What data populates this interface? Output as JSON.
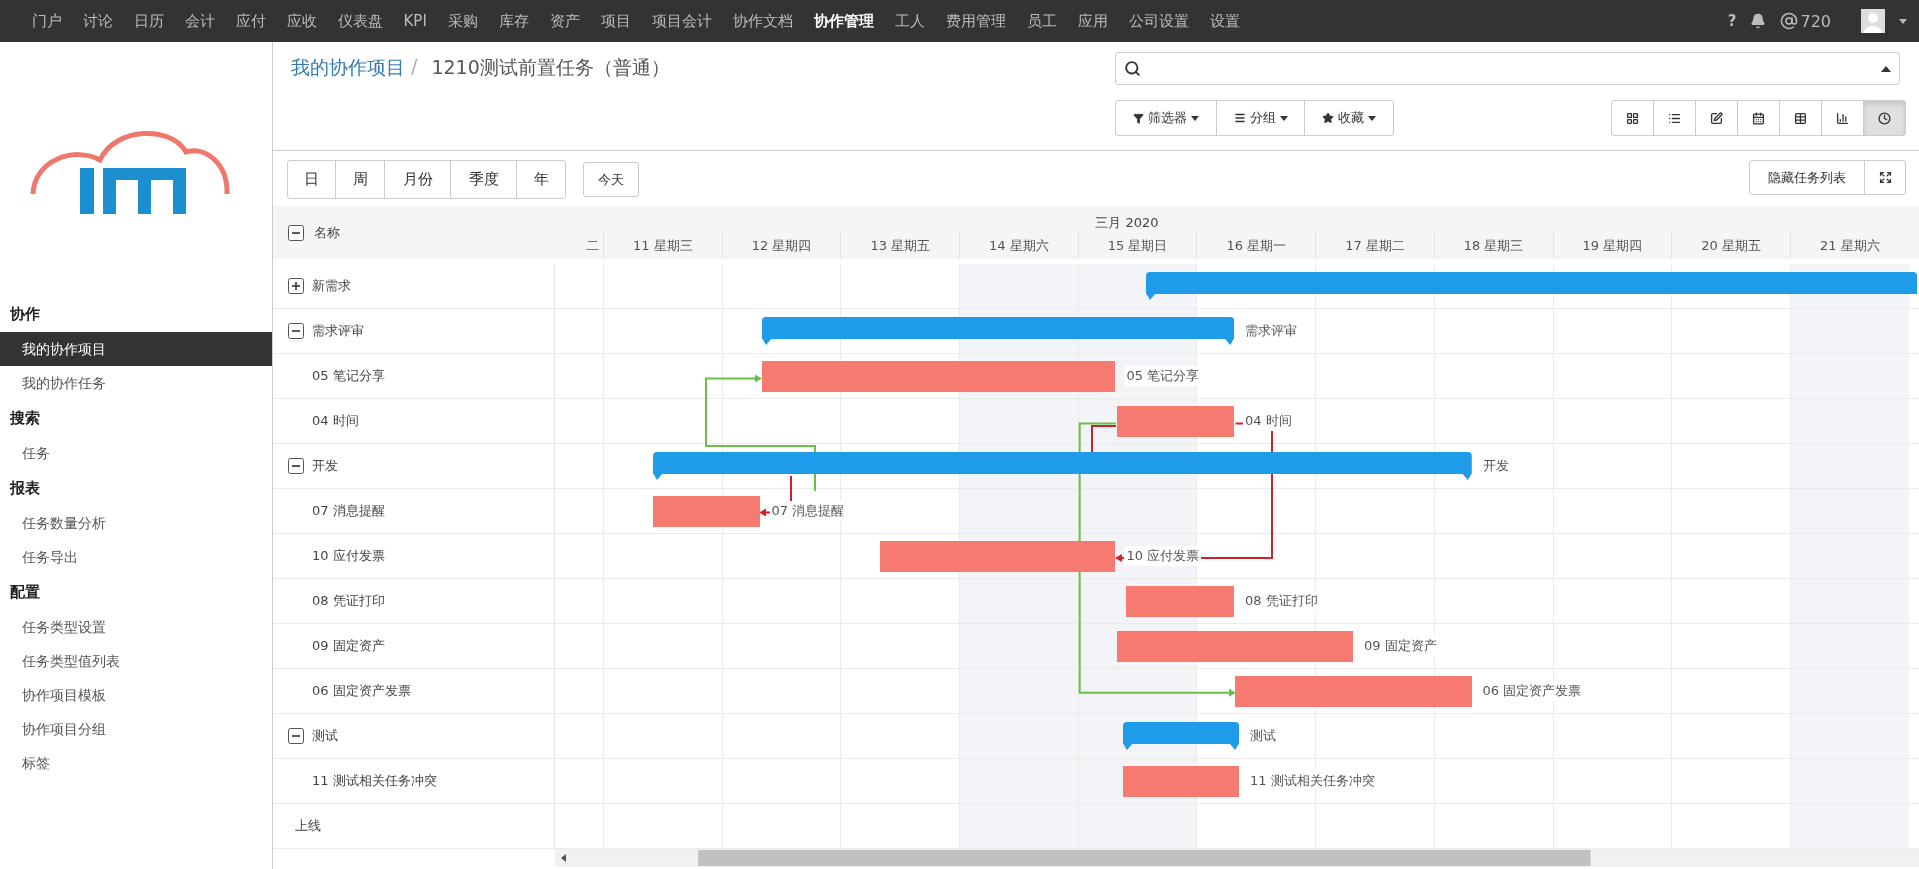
{
  "top_nav": {
    "items": [
      {
        "label": "门户",
        "selected": false
      },
      {
        "label": "讨论",
        "selected": false
      },
      {
        "label": "日历",
        "selected": false
      },
      {
        "label": "会计",
        "selected": false
      },
      {
        "label": "应付",
        "selected": false
      },
      {
        "label": "应收",
        "selected": false
      },
      {
        "label": "仪表盘",
        "selected": false
      },
      {
        "label": "KPI",
        "selected": false
      },
      {
        "label": "采购",
        "selected": false
      },
      {
        "label": "库存",
        "selected": false
      },
      {
        "label": "资产",
        "selected": false
      },
      {
        "label": "项目",
        "selected": false
      },
      {
        "label": "项目会计",
        "selected": false
      },
      {
        "label": "协作文档",
        "selected": false
      },
      {
        "label": "协作管理",
        "selected": true
      },
      {
        "label": "工人",
        "selected": false
      },
      {
        "label": "费用管理",
        "selected": false
      },
      {
        "label": "员工",
        "selected": false
      },
      {
        "label": "应用",
        "selected": false
      },
      {
        "label": "公司设置",
        "selected": false
      },
      {
        "label": "设置",
        "selected": false
      }
    ],
    "help": "?",
    "mentions": "720"
  },
  "sidebar": {
    "sections": [
      {
        "title": "协作",
        "items": [
          {
            "label": "我的协作项目",
            "selected": true
          },
          {
            "label": "我的协作任务",
            "selected": false
          }
        ]
      },
      {
        "title": "搜索",
        "items": [
          {
            "label": "任务",
            "selected": false
          }
        ]
      },
      {
        "title": "报表",
        "items": [
          {
            "label": "任务数量分析",
            "selected": false
          },
          {
            "label": "任务导出",
            "selected": false
          }
        ]
      },
      {
        "title": "配置",
        "items": [
          {
            "label": "任务类型设置",
            "selected": false
          },
          {
            "label": "任务类型值列表",
            "selected": false
          },
          {
            "label": "协作项目模板",
            "selected": false
          },
          {
            "label": "协作项目分组",
            "selected": false
          },
          {
            "label": "标签",
            "selected": false
          }
        ]
      }
    ]
  },
  "breadcrumb": {
    "parent": "我的协作项目",
    "separator": "/",
    "current": "1210测试前置任务（普通）"
  },
  "filters": [
    {
      "kind": "filter",
      "label": "筛选器"
    },
    {
      "kind": "group",
      "label": "分组"
    },
    {
      "kind": "favorite",
      "label": "收藏"
    }
  ],
  "views": [
    {
      "kind": "kanban",
      "selected": false
    },
    {
      "kind": "list",
      "selected": false
    },
    {
      "kind": "form",
      "selected": false
    },
    {
      "kind": "calendar",
      "selected": false
    },
    {
      "kind": "pivot",
      "selected": false
    },
    {
      "kind": "graph",
      "selected": false
    },
    {
      "kind": "gantt",
      "selected": true
    }
  ],
  "scales": [
    "日",
    "周",
    "月份",
    "季度",
    "年"
  ],
  "today": "今天",
  "hide_task_list": "隐藏任务列表",
  "gantt": {
    "name_header": "名称",
    "month": "三月 2020",
    "days": [
      {
        "label": "二",
        "weekend": false
      },
      {
        "label": "11 星期三",
        "weekend": false
      },
      {
        "label": "12 星期四",
        "weekend": false
      },
      {
        "label": "13 星期五",
        "weekend": false
      },
      {
        "label": "14 星期六",
        "weekend": true
      },
      {
        "label": "15 星期日",
        "weekend": true
      },
      {
        "label": "16 星期一",
        "weekend": false
      },
      {
        "label": "17 星期二",
        "weekend": false
      },
      {
        "label": "18 星期三",
        "weekend": false
      },
      {
        "label": "19 星期四",
        "weekend": false
      },
      {
        "label": "20 星期五",
        "weekend": false
      },
      {
        "label": "21 星期六",
        "weekend": true
      }
    ],
    "rows": [
      {
        "kind": "group",
        "label": "新需求",
        "expanded": false
      },
      {
        "kind": "group",
        "label": "需求评审",
        "expanded": true,
        "bar_label": "需求评审"
      },
      {
        "kind": "task",
        "label": "05 笔记分享",
        "bar_label": "05 笔记分享"
      },
      {
        "kind": "task",
        "label": "04 时间",
        "bar_label": "04 时间"
      },
      {
        "kind": "group",
        "label": "开发",
        "expanded": true,
        "bar_label": "开发"
      },
      {
        "kind": "task",
        "label": "07 消息提醒",
        "bar_label": "07 消息提醒"
      },
      {
        "kind": "task",
        "label": "10 应付发票",
        "bar_label": "10 应付发票"
      },
      {
        "kind": "task",
        "label": "08 凭证打印",
        "bar_label": "08 凭证打印"
      },
      {
        "kind": "task",
        "label": "09 固定资产",
        "bar_label": "09 固定资产"
      },
      {
        "kind": "task",
        "label": "06 固定资产发票",
        "bar_label": "06 固定资产发票"
      },
      {
        "kind": "group",
        "label": "测试",
        "expanded": true,
        "bar_label": "测试"
      },
      {
        "kind": "task",
        "label": "11 测试相关任务冲突",
        "bar_label": "11 测试相关任务冲突"
      },
      {
        "kind": "plain",
        "label": "上线"
      }
    ]
  }
}
